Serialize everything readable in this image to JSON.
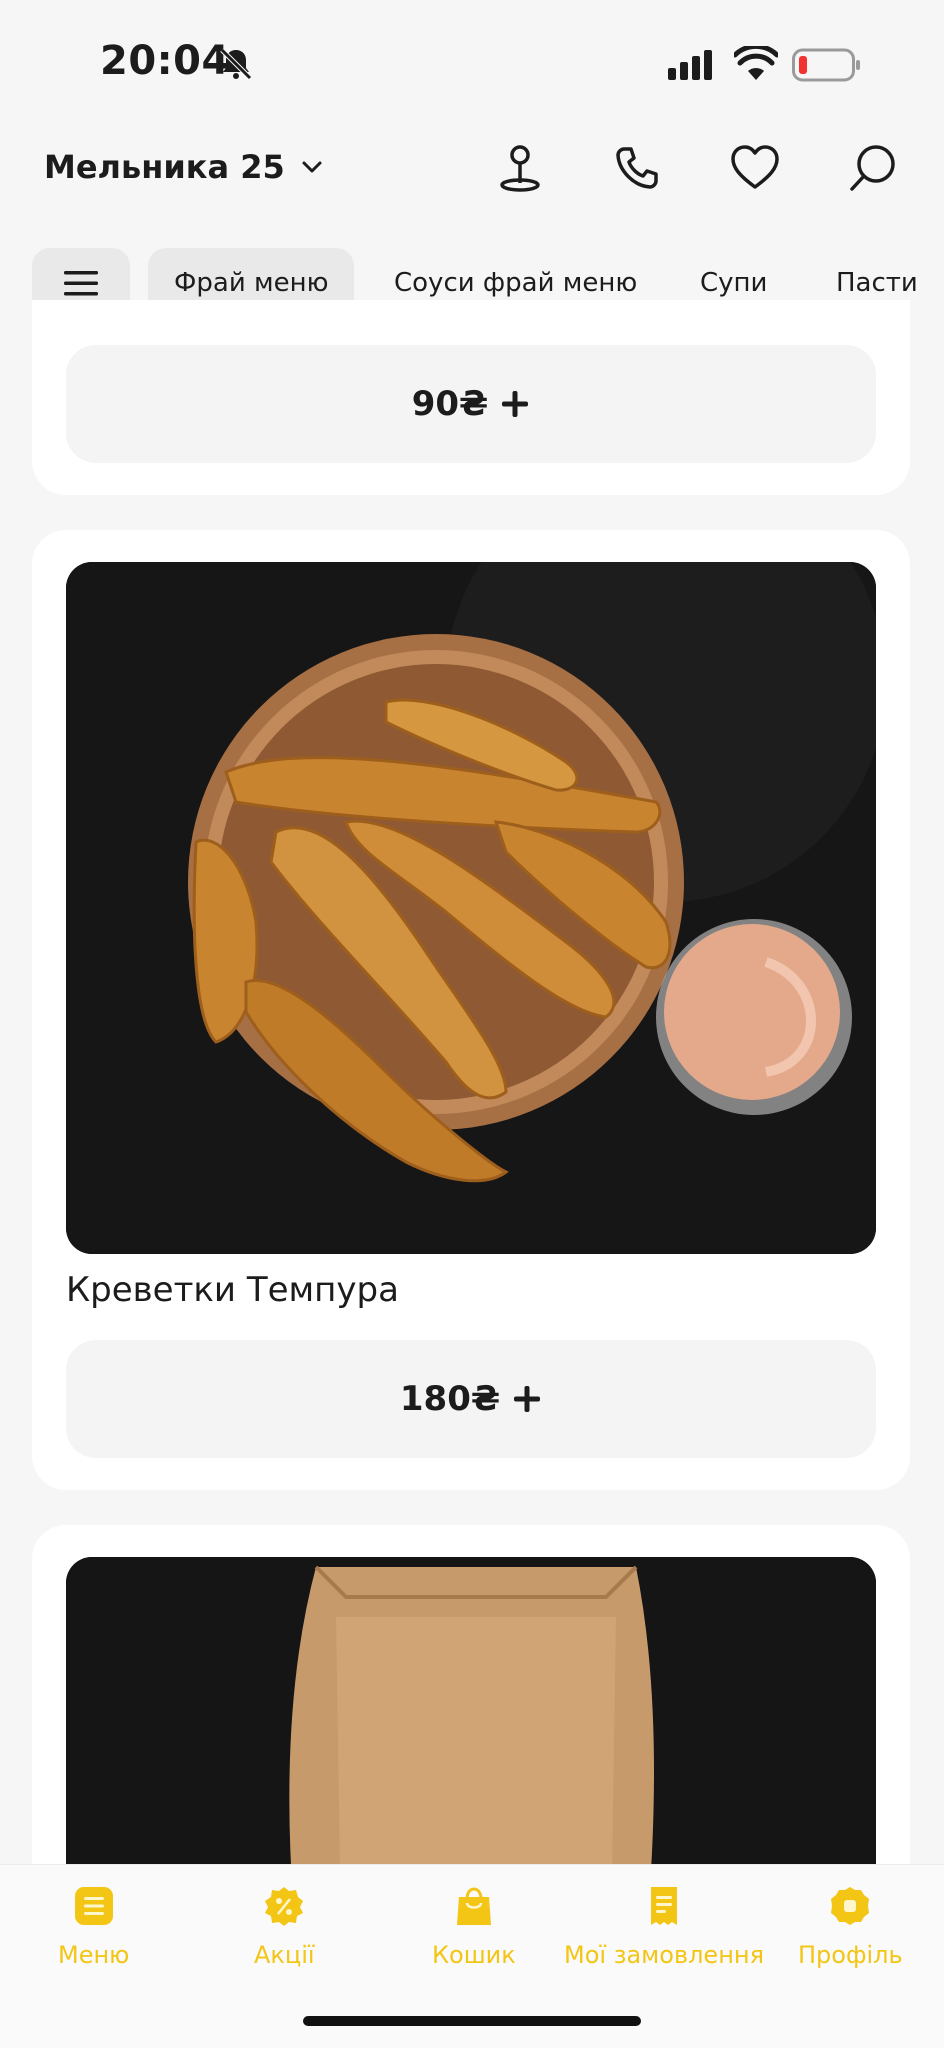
{
  "status": {
    "time": "20:04"
  },
  "header": {
    "address": "Мельника 25"
  },
  "categories": [
    {
      "label": "Фрай меню"
    },
    {
      "label": "Соуси фрай меню"
    },
    {
      "label": "Супи"
    },
    {
      "label": "Пасти"
    }
  ],
  "items": [
    {
      "price": "90₴"
    },
    {
      "name": "Креветки Темпура",
      "price": "180₴"
    }
  ],
  "nav": [
    {
      "label": "Меню"
    },
    {
      "label": "Акції"
    },
    {
      "label": "Кошик"
    },
    {
      "label": "Мої замовлення"
    },
    {
      "label": "Профіль"
    }
  ],
  "colors": {
    "accent": "#f3c515",
    "background": "#f6f6f6",
    "card": "#ffffff"
  }
}
